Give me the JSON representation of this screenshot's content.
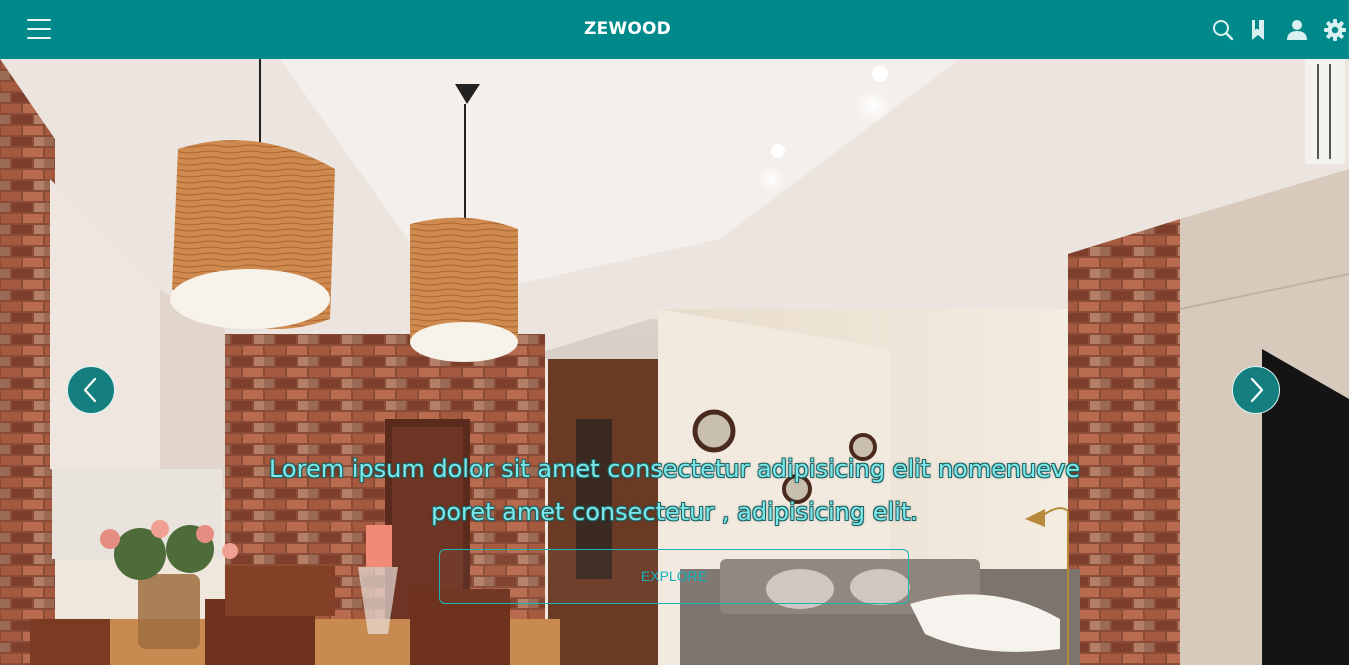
{
  "header": {
    "brand": "ZEWOOD",
    "menu_icon": "hamburger-menu-icon",
    "actions": [
      {
        "name": "search",
        "icon": "search-icon"
      },
      {
        "name": "bookmarks",
        "icon": "bookmark-icon"
      },
      {
        "name": "account",
        "icon": "user-icon"
      },
      {
        "name": "settings",
        "icon": "gear-icon"
      }
    ]
  },
  "hero": {
    "image": "living room interior with wooden pendant lamps, brick walls and grey sofa",
    "headline_line1": "Lorem ipsum dolor sit amet consectetur adipisicing elit nomenueve",
    "headline_line2": "poret amet consectetur , adipisicing elit.",
    "cta_label": "EXPLORE",
    "prev_icon": "chevron-left-icon",
    "next_icon": "chevron-right-icon"
  },
  "colors": {
    "header_bg": "#00898a",
    "accent": "#1bb3b6",
    "headline_text": "#7de8e9",
    "arrow_bg": "#157f80"
  }
}
